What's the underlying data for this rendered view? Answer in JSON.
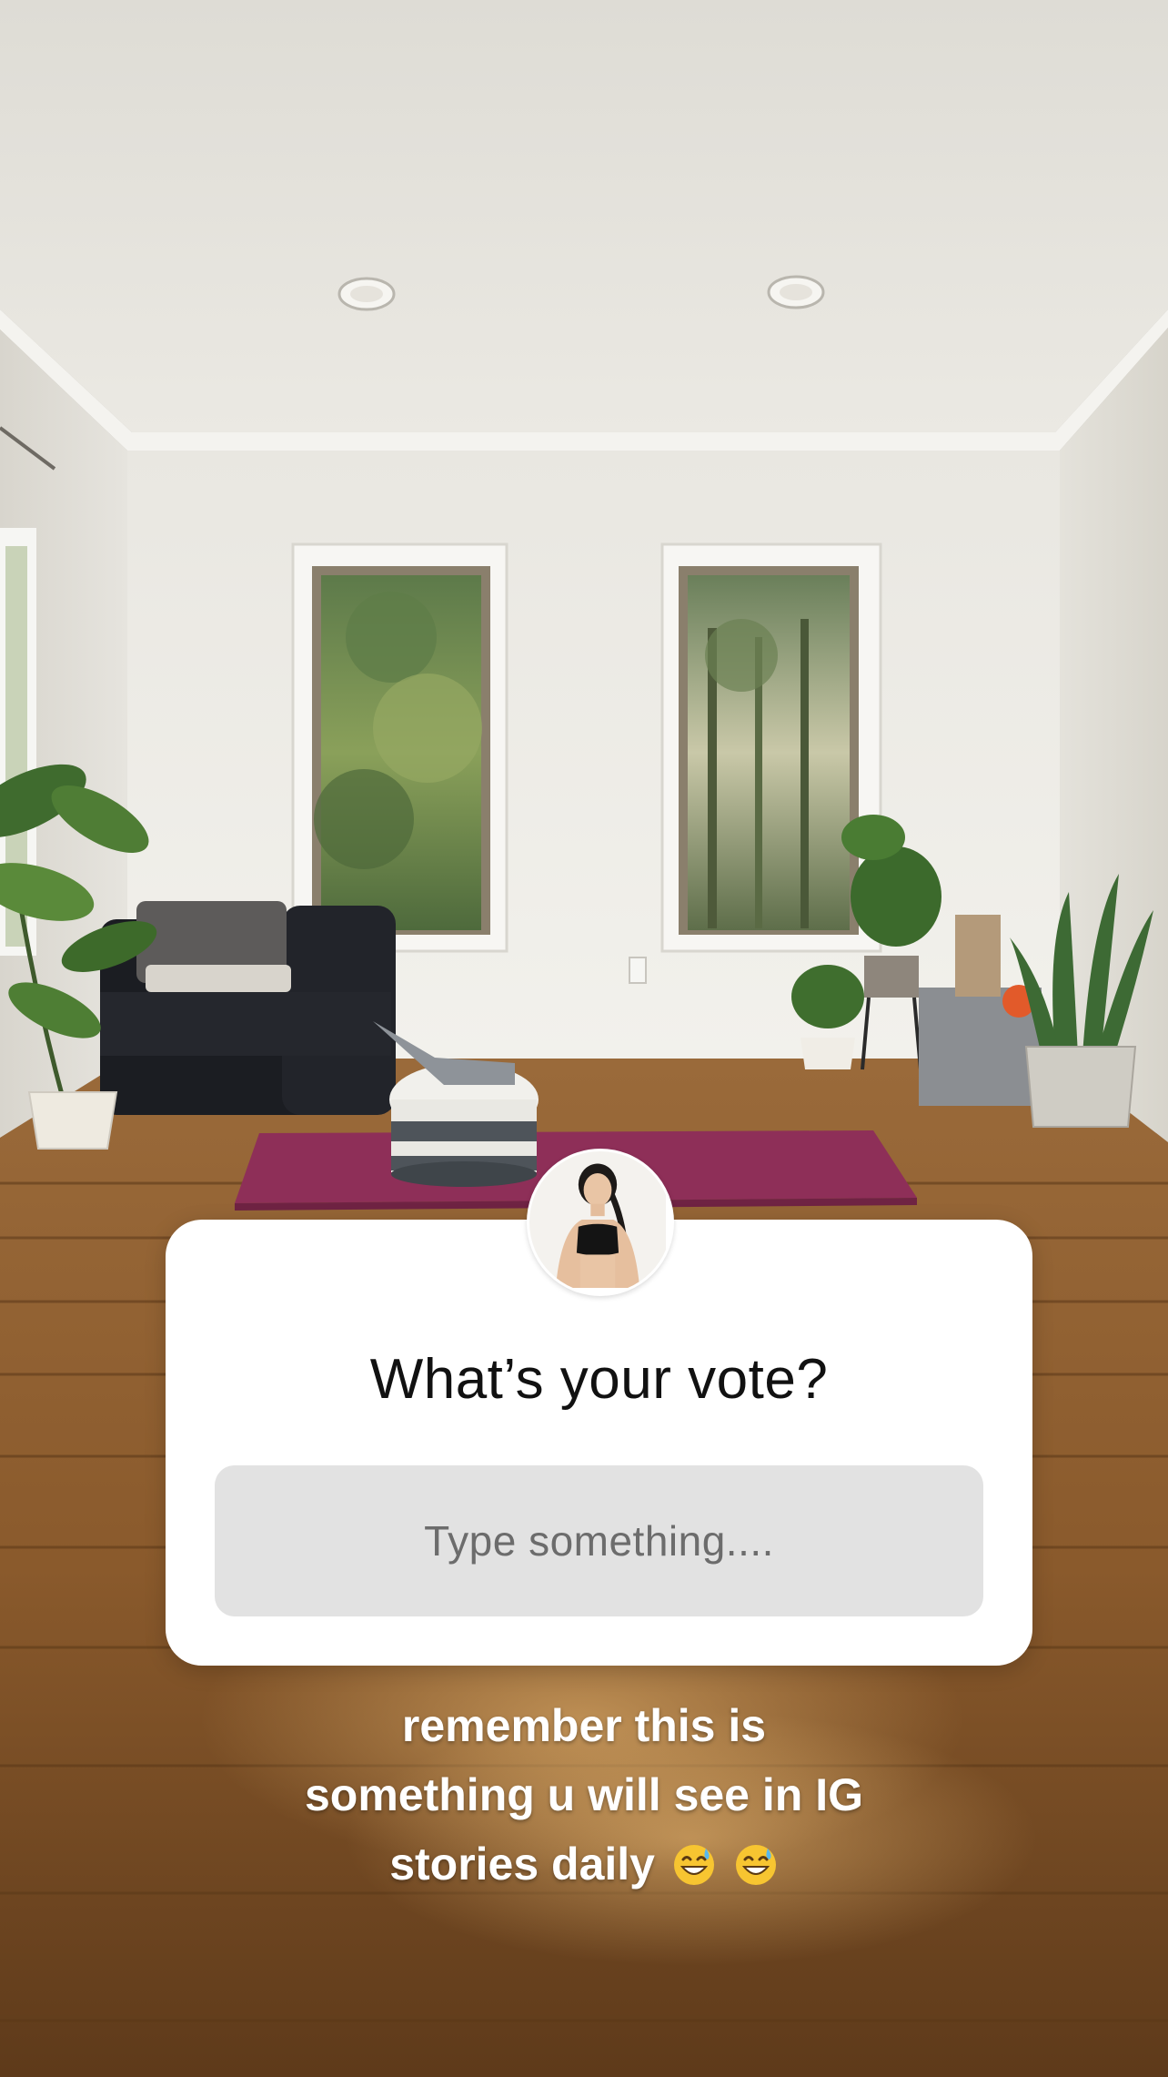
{
  "story": {
    "question_sticker": {
      "prompt": "What’s your vote?",
      "input_placeholder": "Type something...."
    },
    "caption": {
      "line1": "remember this is",
      "line2": "something u will see in IG",
      "line3": "stories daily",
      "emojis": [
        "grinning-face-with-sweat-icon",
        "grinning-face-with-sweat-icon"
      ]
    },
    "avatar_icon": "profile-photo-icon"
  },
  "colors": {
    "card": "#ffffff",
    "input_bg": "#e2e2e2",
    "placeholder": "#6c6c6c",
    "caption": "#ffffff",
    "mat": "#8e2f58",
    "floor": "#8a5a2c"
  }
}
